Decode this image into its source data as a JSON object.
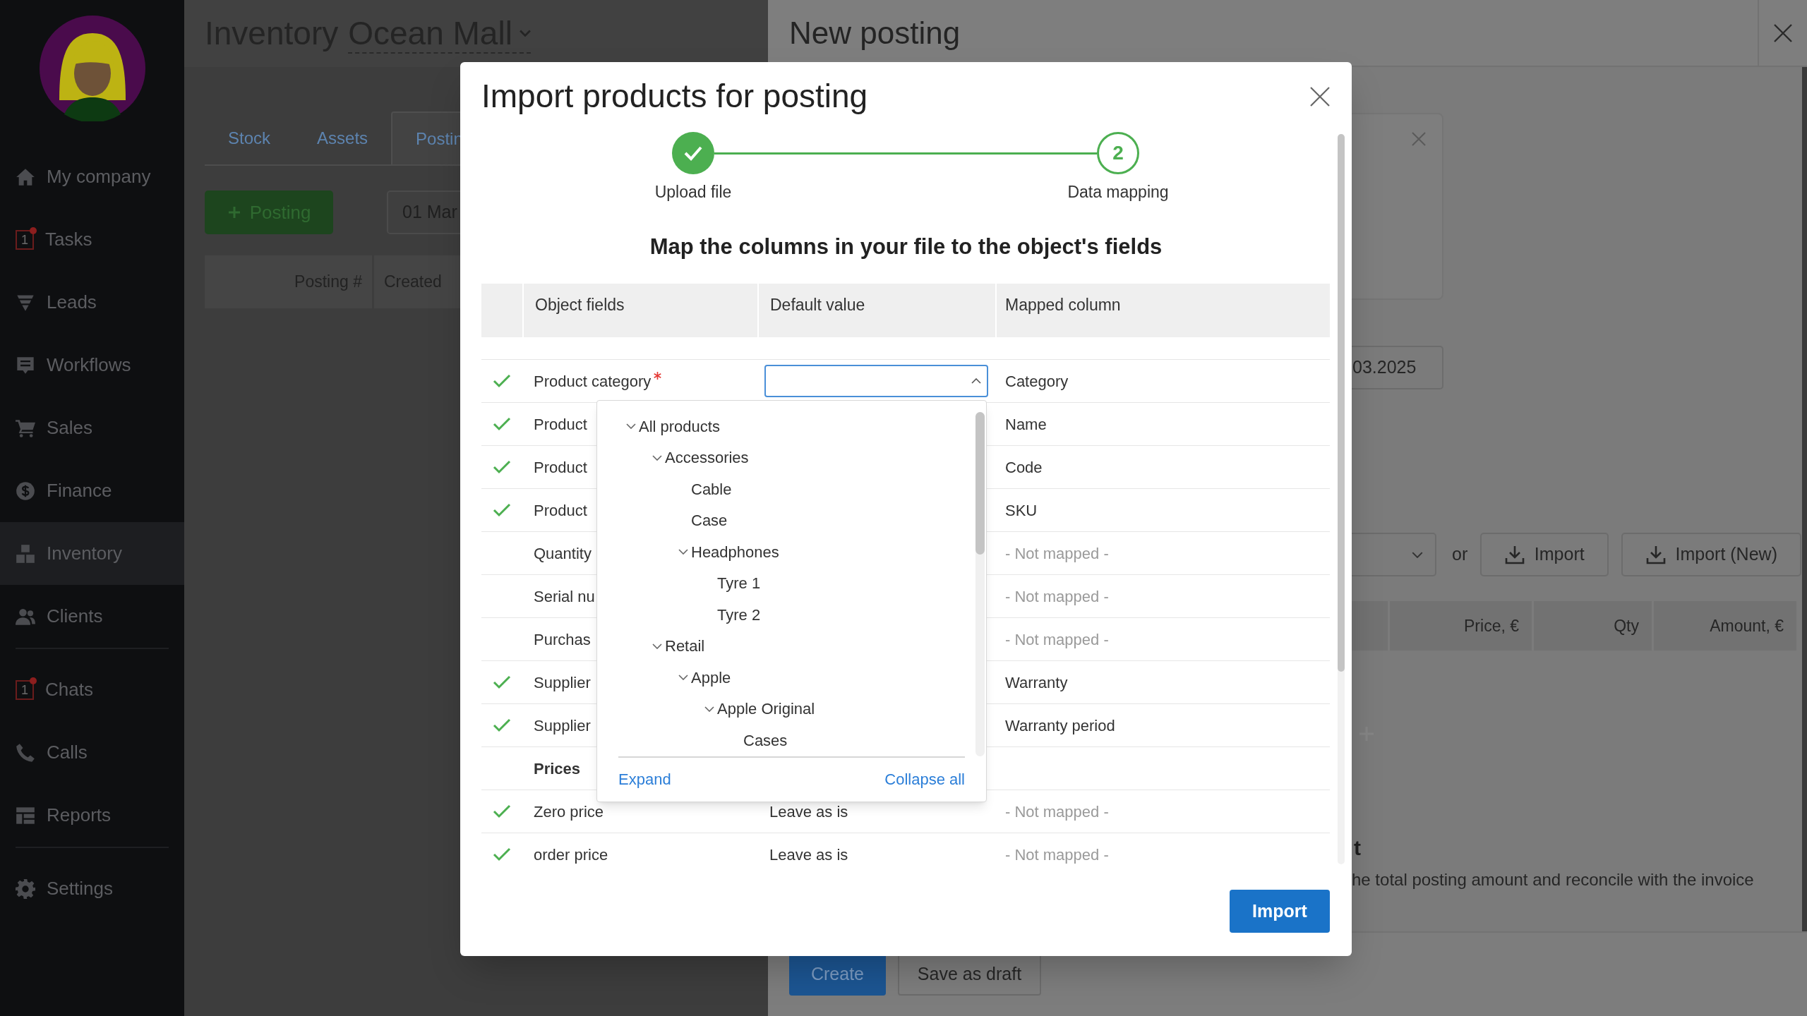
{
  "sidebar": {
    "groups": [
      [
        {
          "label": "My company",
          "selected": false
        },
        {
          "label": "Tasks",
          "badge": "1",
          "selected": false
        },
        {
          "label": "Leads",
          "selected": false
        },
        {
          "label": "Workflows",
          "selected": false
        },
        {
          "label": "Sales",
          "selected": false
        },
        {
          "label": "Finance",
          "selected": false
        },
        {
          "label": "Inventory",
          "selected": true
        },
        {
          "label": "Clients",
          "selected": false
        }
      ],
      [
        {
          "label": "Chats",
          "badge": "1",
          "selected": false
        },
        {
          "label": "Calls",
          "selected": false
        },
        {
          "label": "Reports",
          "selected": false
        }
      ],
      [
        {
          "label": "Settings",
          "selected": false
        }
      ]
    ]
  },
  "page": {
    "title": "Inventory",
    "location": "Ocean Mall",
    "tabs": [
      {
        "label": "Stock",
        "selected": false
      },
      {
        "label": "Assets",
        "selected": false
      },
      {
        "label": "Postin",
        "selected": true
      }
    ],
    "add_button": "Posting",
    "date_filter": "01 Mar",
    "table": {
      "columns": [
        "Posting #",
        "Created"
      ]
    }
  },
  "panel": {
    "title": "New posting",
    "date_field": "03.2025",
    "or_text": "or",
    "import_buttons": [
      "Import",
      "Import (New)"
    ],
    "table": {
      "columns": [
        "Price, €",
        "Qty",
        "Amount, €"
      ]
    },
    "heading": "t",
    "hint": "he total posting amount and reconcile with the invoice",
    "buttons": [
      {
        "label": "Create",
        "kind": "primary"
      },
      {
        "label": "Save as draft",
        "kind": "secondary"
      }
    ]
  },
  "dialog": {
    "title": "Import products for posting",
    "steps": [
      {
        "label": "Upload file",
        "done": true
      },
      {
        "label": "Data mapping",
        "number": "2",
        "done": false
      }
    ],
    "heading": "Map the columns in your file to the object's fields",
    "columns": [
      "Object fields",
      "Default value",
      "Mapped column"
    ],
    "rows": [
      {
        "kind": "field",
        "mapped": true,
        "field": "Product category",
        "required": true,
        "default_select": {
          "open": true
        },
        "mapped_column": "Category",
        "column_chosen": true
      },
      {
        "kind": "field",
        "mapped": true,
        "field": "Product",
        "required": false,
        "mapped_column": "Name",
        "column_chosen": true
      },
      {
        "kind": "field",
        "mapped": true,
        "field": "Product",
        "required": false,
        "mapped_column": "Code",
        "column_chosen": true
      },
      {
        "kind": "field",
        "mapped": true,
        "field": "Product",
        "required": false,
        "mapped_column": "SKU",
        "column_chosen": true
      },
      {
        "kind": "field",
        "mapped": false,
        "field": "Quantity",
        "required": false,
        "mapped_column": "- Not mapped -",
        "column_chosen": false
      },
      {
        "kind": "field",
        "mapped": false,
        "field": "Serial nu",
        "required": false,
        "mapped_column": "- Not mapped -",
        "column_chosen": false
      },
      {
        "kind": "field",
        "mapped": false,
        "field": "Purchas",
        "required": false,
        "mapped_column": "- Not mapped -",
        "column_chosen": false
      },
      {
        "kind": "field",
        "mapped": true,
        "field": "Supplier",
        "required": false,
        "mapped_column": "Warranty",
        "column_chosen": true
      },
      {
        "kind": "field",
        "mapped": true,
        "field": "Supplier",
        "required": false,
        "mapped_column": "Warranty period",
        "column_chosen": true
      },
      {
        "kind": "section",
        "label": "Prices"
      },
      {
        "kind": "field",
        "mapped": true,
        "field": "Zero price",
        "required": false,
        "default": "Leave as is",
        "mapped_column": "- Not mapped -",
        "column_chosen": false
      },
      {
        "kind": "field",
        "mapped": true,
        "field": "order price",
        "required": false,
        "default": "Leave as is",
        "mapped_column": "- Not mapped -",
        "column_chosen": false
      }
    ],
    "dropdown": {
      "tree": [
        {
          "label": "All products",
          "expanded": true,
          "children": [
            {
              "label": "Accessories",
              "expanded": true,
              "children": [
                {
                  "label": "Cable"
                },
                {
                  "label": "Case"
                },
                {
                  "label": "Headphones",
                  "expanded": true,
                  "children": [
                    {
                      "label": "Tyre 1"
                    },
                    {
                      "label": "Tyre 2"
                    }
                  ]
                }
              ]
            },
            {
              "label": "Retail",
              "expanded": true,
              "children": [
                {
                  "label": "Apple",
                  "expanded": true,
                  "children": [
                    {
                      "label": "Apple Original",
                      "expanded": true,
                      "children": [
                        {
                          "label": "Cases"
                        }
                      ]
                    }
                  ]
                }
              ]
            }
          ]
        }
      ],
      "expand_link": "Expand",
      "collapse_link": "Collapse all"
    },
    "import_button": "Import"
  }
}
